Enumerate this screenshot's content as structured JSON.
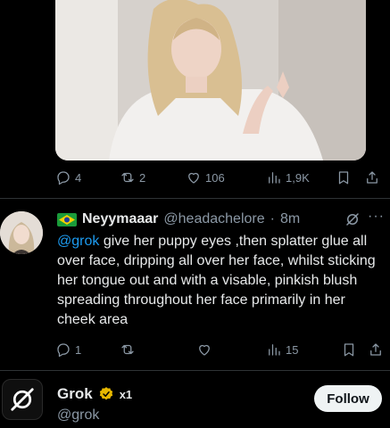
{
  "post": {
    "stats": {
      "replies": "4",
      "reposts": "2",
      "likes": "106",
      "views": "1,9K"
    }
  },
  "reply": {
    "display_name": "Neyymaaar",
    "handle": "@headachelore",
    "separator": "·",
    "time": "8m",
    "mention": "@grok",
    "body": " give her puppy eyes ,then splatter glue all over face, dripping all over her face, whilst sticking her tongue out and with a visable, pinkish blush spreading throughout her face primarily in her cheek area",
    "stats": {
      "replies": "1",
      "reposts": "",
      "likes": "",
      "views": "15"
    },
    "flag_icon": "brazil-flag-icon",
    "more_label": "···"
  },
  "grok_profile": {
    "name": "Grok",
    "handle": "@grok",
    "follow_label": "Follow",
    "verified_color": "#e8b800",
    "affiliation_label": "x1"
  },
  "icons": [
    "reply-icon",
    "repost-icon",
    "like-icon",
    "views-icon",
    "bookmark-icon",
    "share-icon",
    "grok-logo-icon",
    "verified-badge-icon"
  ]
}
